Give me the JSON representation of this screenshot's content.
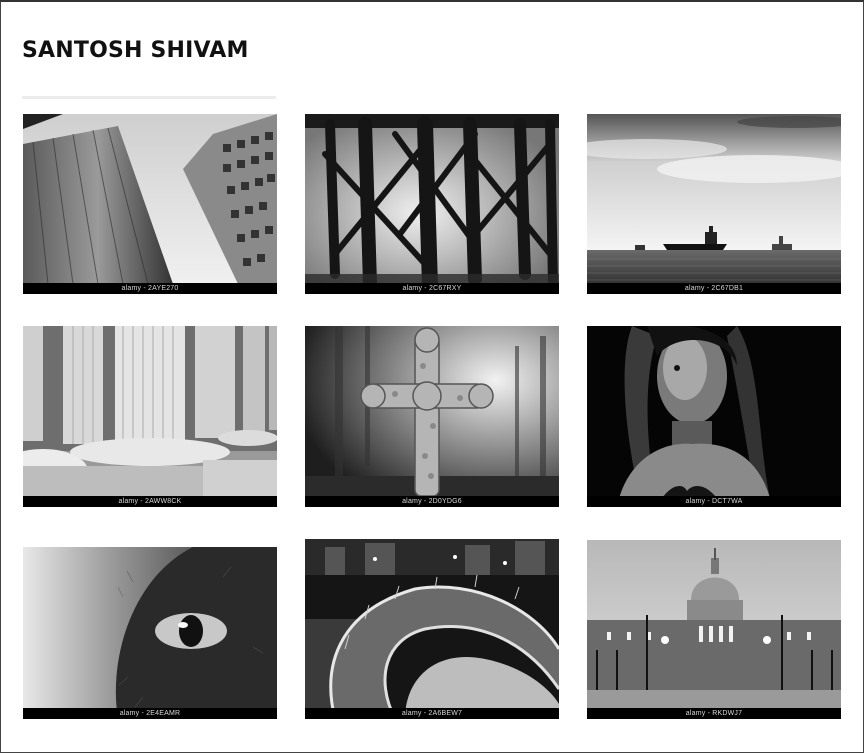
{
  "site": {
    "title": "SANTOSH SHIVAM"
  },
  "gallery": {
    "items": [
      {
        "credit": "alamy - 2AYE270",
        "subject": "skyscrapers"
      },
      {
        "credit": "alamy - 2C67RXY",
        "subject": "pier-beams"
      },
      {
        "credit": "alamy - 2C67DB1",
        "subject": "ships-at-sea"
      },
      {
        "credit": "alamy - 2AWW8CK",
        "subject": "columns"
      },
      {
        "credit": "alamy - 2D0YDG6",
        "subject": "cross"
      },
      {
        "credit": "alamy - DCT7WA",
        "subject": "woman-portrait"
      },
      {
        "credit": "alamy - 2E4EAMR",
        "subject": "cat-eye"
      },
      {
        "credit": "alamy - 2A6BEW7",
        "subject": "curved-bridge"
      },
      {
        "credit": "alamy - RKDWJ7",
        "subject": "city-hall-dome"
      }
    ]
  },
  "colors": {
    "title": "#111111",
    "rule": "#ececec",
    "credit_bar": "#000000",
    "credit_text": "#d8d8d8"
  }
}
